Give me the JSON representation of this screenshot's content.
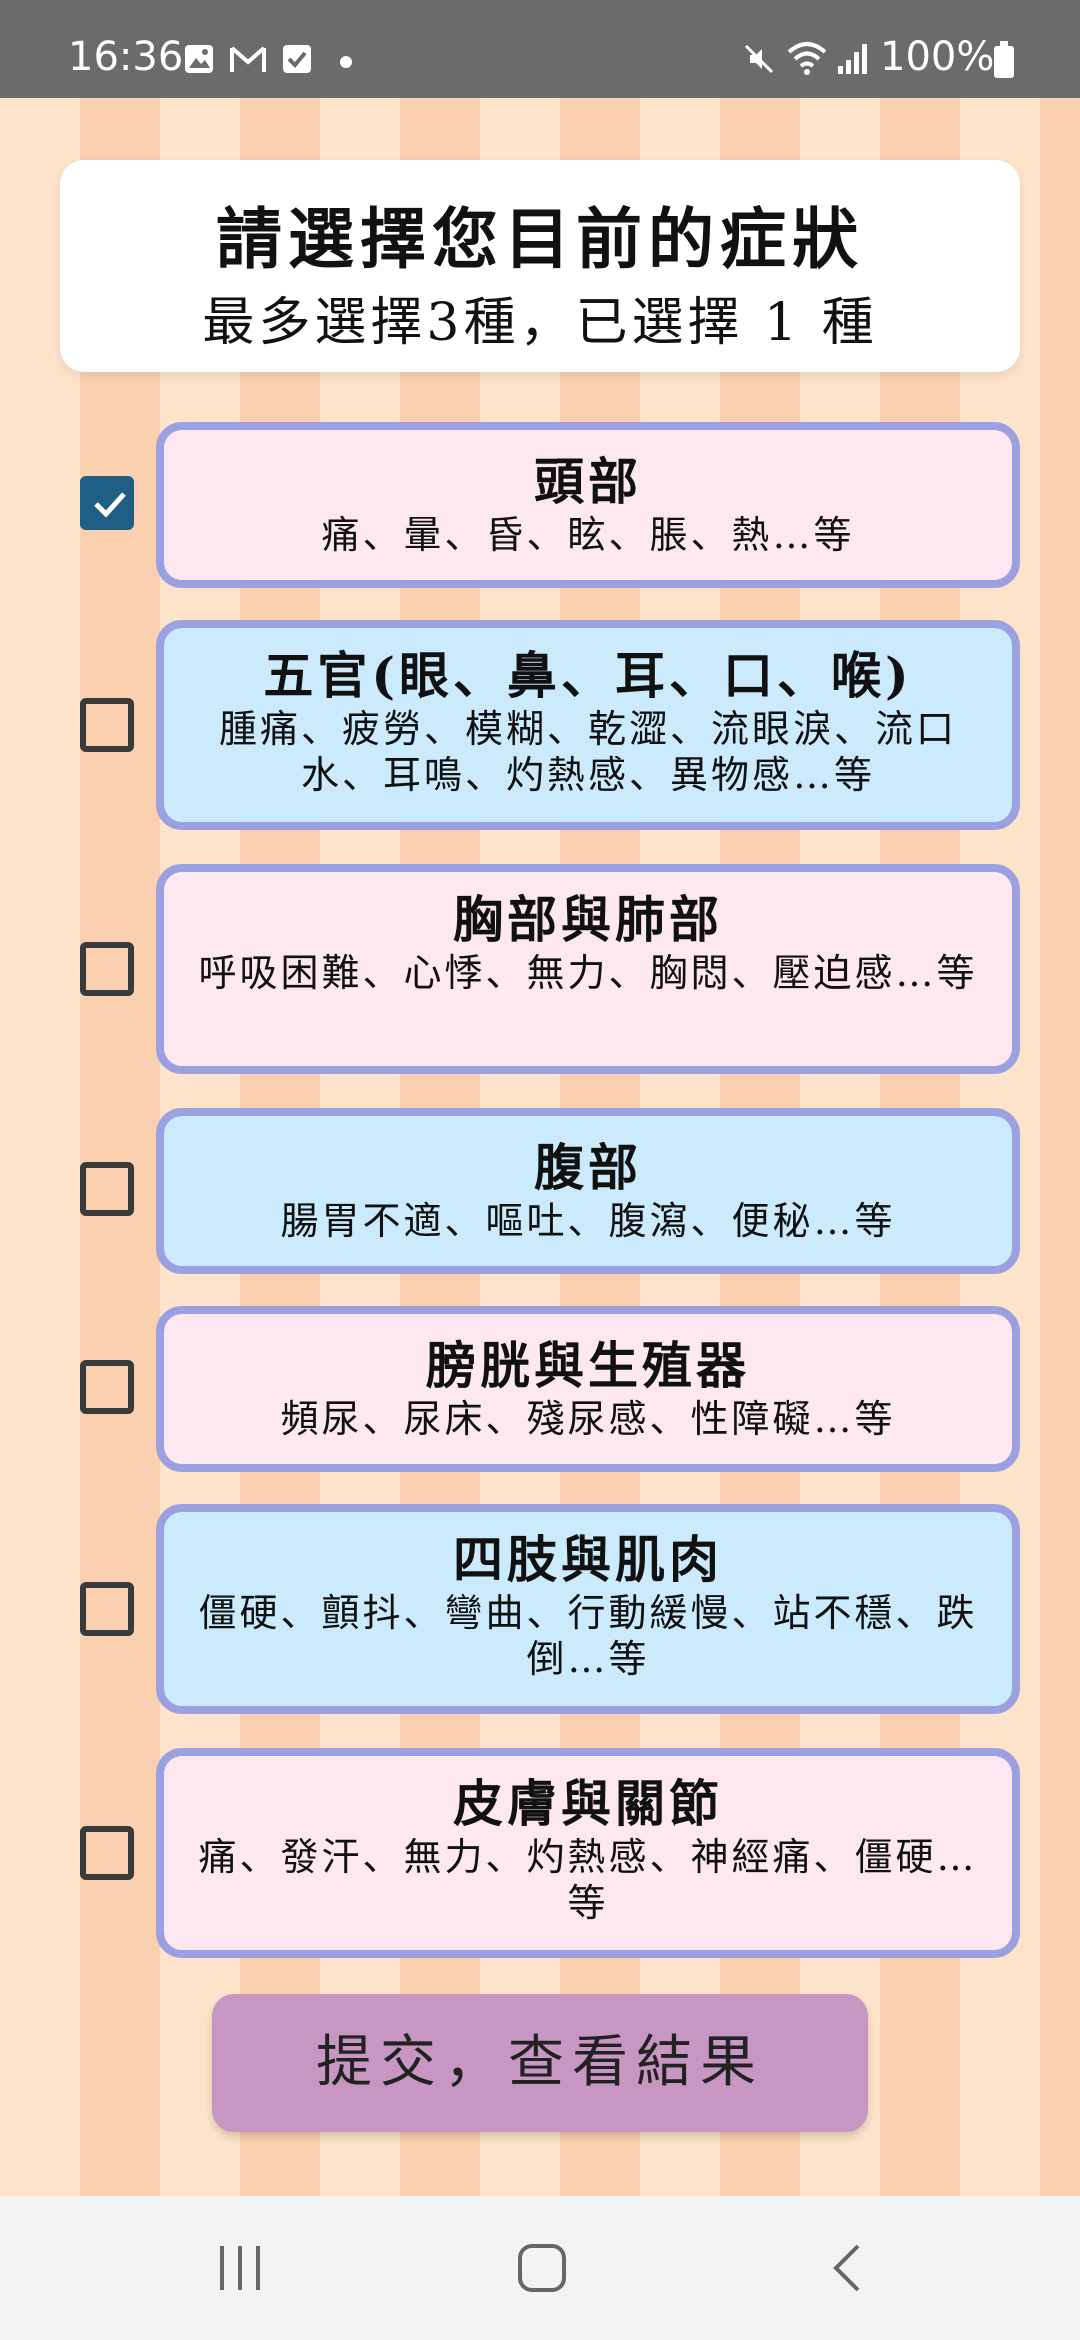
{
  "status_bar": {
    "time": "16:36",
    "battery": "100%",
    "icons": [
      "gallery-icon",
      "gmail-icon",
      "checkbox-notification-icon",
      "mute-icon",
      "wifi-icon",
      "signal-icon",
      "battery-icon"
    ]
  },
  "header": {
    "title": "請選擇您目前的症狀",
    "subtitle": "最多選擇3種，已選擇 1 種"
  },
  "symptoms": [
    {
      "title": "頭部",
      "desc": "痛、暈、昏、眩、脹、熱…等",
      "checked": true,
      "color": "#fde8f1"
    },
    {
      "title": "五官(眼、鼻、耳、口、喉)",
      "desc": "腫痛、疲勞、模糊、乾澀、流眼淚、流口水、耳鳴、灼熱感、異物感…等",
      "checked": false,
      "color": "#cbeafb"
    },
    {
      "title": "胸部與肺部",
      "desc": "呼吸困難、心悸、無力、胸悶、壓迫感…等",
      "checked": false,
      "color": "#fde8f1"
    },
    {
      "title": "腹部",
      "desc": "腸胃不適、嘔吐、腹瀉、便秘…等",
      "checked": false,
      "color": "#cbeafb"
    },
    {
      "title": "膀胱與生殖器",
      "desc": "頻尿、尿床、殘尿感、性障礙…等",
      "checked": false,
      "color": "#fde8f1"
    },
    {
      "title": "四肢與肌肉",
      "desc": "僵硬、顫抖、彎曲、行動緩慢、站不穩、跌倒…等",
      "checked": false,
      "color": "#cbeafb"
    },
    {
      "title": "皮膚與關節",
      "desc": "痛、發汗、無力、灼熱感、神經痛、僵硬…等",
      "checked": false,
      "color": "#fde8f1"
    }
  ],
  "submit": {
    "label": "提交，查看結果"
  },
  "colors": {
    "card_border": "#9aa0e0",
    "checked": "#1f5f86",
    "submit_bg": "#c796c2"
  },
  "nav_bar": {
    "icons": [
      "recent-apps-icon",
      "home-icon",
      "back-icon"
    ]
  }
}
